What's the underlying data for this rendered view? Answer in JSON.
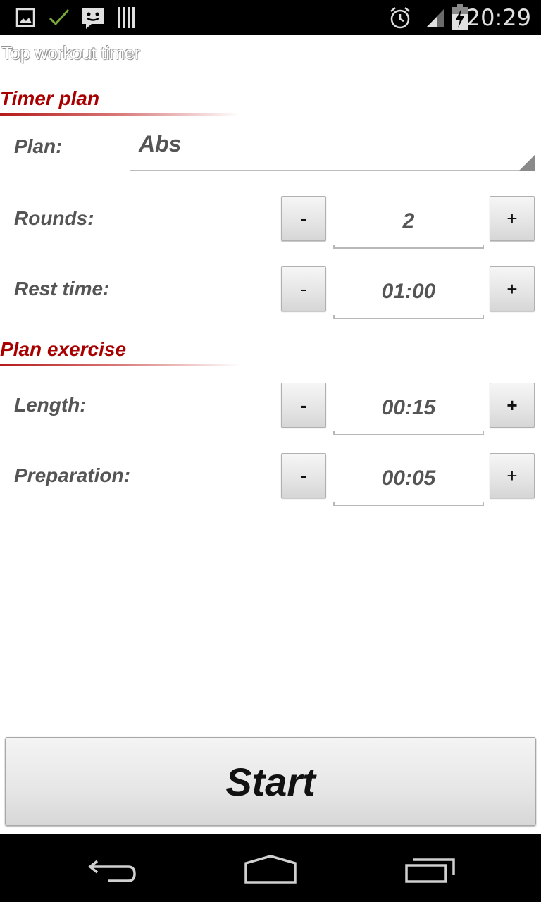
{
  "status_bar": {
    "time": "20:29",
    "left_icons": [
      "picture-icon",
      "check-icon",
      "message-icon",
      "barcode-icon"
    ],
    "right_icons": [
      "alarm-icon",
      "signal-icon",
      "battery-charging-icon"
    ]
  },
  "app": {
    "title": "Top workout timer"
  },
  "timer_plan": {
    "header": "Timer plan",
    "plan_label": "Plan:",
    "plan_value": "Abs",
    "rounds": {
      "label": "Rounds:",
      "value": "2",
      "minus": "-",
      "plus": "+"
    },
    "rest_time": {
      "label": "Rest time:",
      "value": "01:00",
      "minus": "-",
      "plus": "+"
    }
  },
  "plan_exercise": {
    "header": "Plan exercise",
    "length": {
      "label": "Length:",
      "value": "00:15",
      "minus": "-",
      "plus": "+"
    },
    "preparation": {
      "label": "Preparation:",
      "value": "00:05",
      "minus": "-",
      "plus": "+"
    }
  },
  "start_button": {
    "label": "Start"
  },
  "nav_bar": {
    "icons": [
      "back-icon",
      "home-icon",
      "recent-apps-icon"
    ]
  },
  "colors": {
    "section_header": "#a80000",
    "label_text": "#555555",
    "status_bar_bg": "#000000",
    "nav_bar_bg": "#000000"
  }
}
